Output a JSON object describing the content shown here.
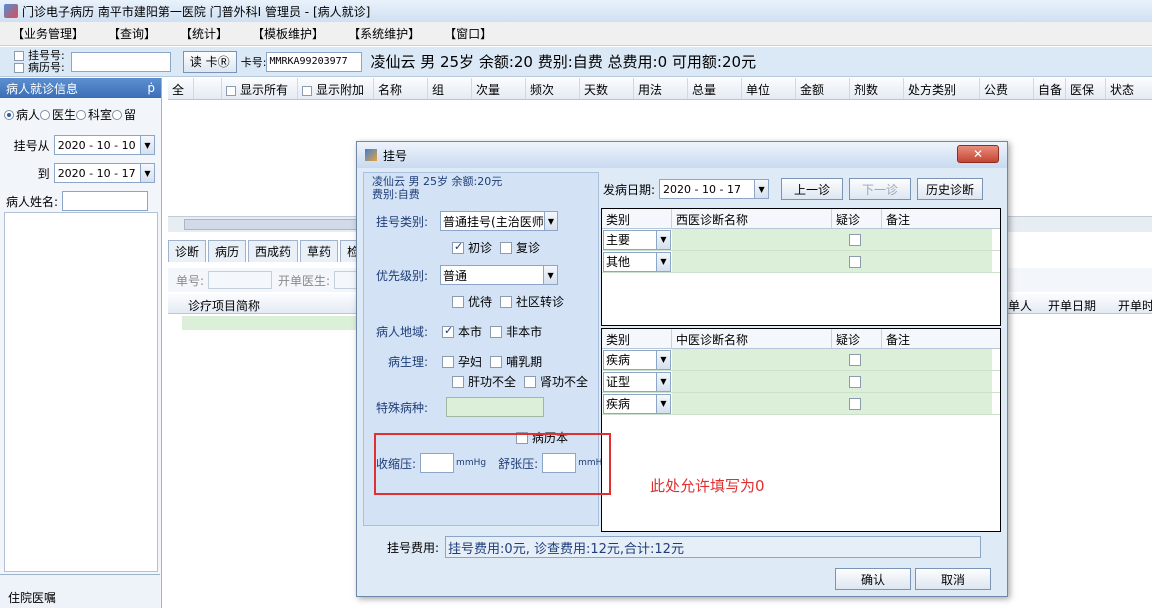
{
  "window": {
    "title": "门诊电子病历  南平市建阳第一医院  门普外科Ⅰ  管理员 - [病人就诊]"
  },
  "menu": [
    "【业务管理】",
    "【查询】",
    "【统计】",
    "【模板维护】",
    "【系统维护】",
    "【窗口】"
  ],
  "toolbar": {
    "reg_no_label": "挂号号:",
    "record_no_label": "病历号:",
    "read_card_button": "读 卡Ⓡ",
    "card_label": "卡号:",
    "card_value": "MMRKA99203977",
    "patient_summary": "凌仙云 男 25岁 余额:20 费别:自费 总费用:0 可用额:20元"
  },
  "left_panel": {
    "title": "病人就诊信息",
    "pin": "ṗ",
    "radios": [
      "病人",
      "医生",
      "科室",
      "留"
    ],
    "date_from_label": "挂号从",
    "date_from": "2020 - 10 - 10",
    "date_to_label": "到",
    "date_to": "2020 - 10 - 17",
    "name_label": "病人姓名:",
    "inpatient_tab": "住院医嘱"
  },
  "grid": {
    "all_label": "全",
    "show_all": "显示所有",
    "show_extra": "显示附加",
    "columns": [
      "名称",
      "组",
      "次量",
      "频次",
      "天数",
      "用法",
      "总量",
      "单位",
      "金额",
      "剂数",
      "处方类别",
      "公费",
      "自备",
      "医保",
      "状态"
    ]
  },
  "tabs": [
    "诊断",
    "病历",
    "西成药",
    "草药",
    "检"
  ],
  "order_bar": {
    "order_no_label": "单号:",
    "doctor_label": "开单医生:",
    "col_item": "诊疗项目简称",
    "col_person": "单人",
    "col_date": "开单日期",
    "col_time": "开单时"
  },
  "dialog": {
    "title": "挂号",
    "close": "✕",
    "summary_line1": "凌仙云 男 25岁 余额:20元",
    "summary_line2": "费别:自费",
    "reg_type_label": "挂号类别:",
    "reg_type_value": "普通挂号(主治医师",
    "first_visit": "初诊",
    "revisit": "复诊",
    "priority_label": "优先级别:",
    "priority_value": "普通",
    "preferential": "优待",
    "community_transfer": "社区转诊",
    "region_label": "病人地域:",
    "local": "本市",
    "non_local": "非本市",
    "physiology_label": "病生理:",
    "pregnant": "孕妇",
    "lactation": "哺乳期",
    "liver": "肝功不全",
    "kidney": "肾功不全",
    "special_disease_label": "特殊病种:",
    "record_book": "病历本",
    "systolic_label": "收缩压:",
    "diastolic_label": "舒张压:",
    "unit": "mmHg",
    "onset_date_label": "发病日期:",
    "onset_date": "2020 - 10 - 17",
    "prev_visit": "上一诊",
    "next_visit": "下一诊",
    "history": "历史诊断",
    "west_header": [
      "类别",
      "西医诊断名称",
      "疑诊",
      "备注"
    ],
    "west_rows": [
      "主要",
      "其他"
    ],
    "tcm_header": [
      "类别",
      "中医诊断名称",
      "疑诊",
      "备注"
    ],
    "tcm_rows": [
      "疾病",
      "证型",
      "疾病"
    ],
    "fee_label": "挂号费用:",
    "fee_value": "挂号费用:0元, 诊查费用:12元,合计:12元",
    "ok": "确认",
    "cancel": "取消"
  },
  "annotation": {
    "note": "此处允许填写为0",
    "color": "#e03030"
  }
}
